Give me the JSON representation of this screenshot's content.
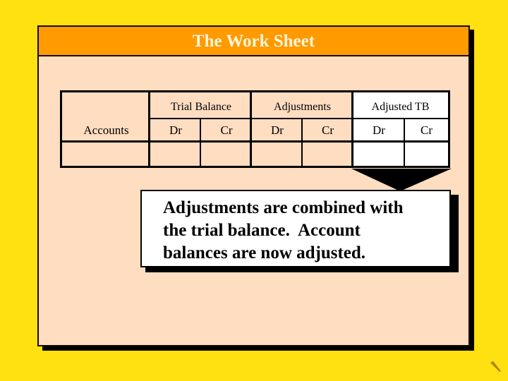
{
  "slide": {
    "title": "The Work Sheet",
    "colors": {
      "background": "#FFE010",
      "header": "#FF9A00",
      "panel": "#FFDDC1",
      "title_text": "#FFF4D8",
      "highlight": "#FFFFFF"
    }
  },
  "worksheet": {
    "accounts_header": "Accounts",
    "groups": [
      {
        "label": "Trial Balance",
        "dr": "Dr",
        "cr": "Cr",
        "highlighted": false
      },
      {
        "label": "Adjustments",
        "dr": "Dr",
        "cr": "Cr",
        "highlighted": false
      },
      {
        "label": "Adjusted TB",
        "dr": "Dr",
        "cr": "Cr",
        "highlighted": true
      }
    ]
  },
  "callout": {
    "lines": [
      "Adjustments are combined with",
      "the trial balance.  Account",
      "balances are now adjusted."
    ]
  },
  "icons": {
    "arrow": "down-arrow-icon",
    "corner": "pencil-icon"
  }
}
